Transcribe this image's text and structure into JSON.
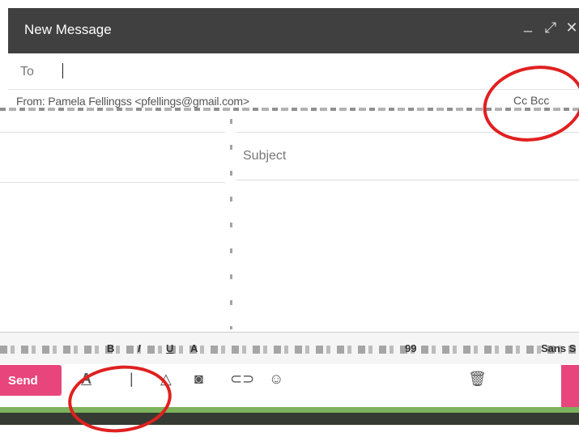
{
  "window": {
    "title": "New Message",
    "minimize_glyph": "_",
    "expand_glyph": "⤢",
    "close_glyph": "✕"
  },
  "compose": {
    "to_label": "To",
    "to_value": "",
    "from_text": "From: Pamela Fellingss <pfellings@gmail.com>",
    "cc_bcc": "Cc Bcc",
    "subject_placeholder": "Subject",
    "body": ""
  },
  "toolbar": {
    "font_family": "Sans S",
    "format_glyphs": {
      "bold": "B",
      "italic": "I",
      "underline": "U",
      "font_color": "A",
      "quote": "99"
    }
  },
  "bottom": {
    "send_label": "Send",
    "icons": [
      "format-text-icon",
      "attach-icon",
      "drive-icon",
      "photo-icon",
      "link-icon",
      "emoji-icon",
      "trash-icon"
    ],
    "format_glyph": "A",
    "attach_glyph": "|",
    "drive_glyph": "△",
    "photo_glyph": "◙",
    "link_glyph": "⊂⊃",
    "emoji_glyph": "☺",
    "trash_glyph": "🗑"
  },
  "colors": {
    "titlebar": "#404040",
    "send_button": "#e8457c",
    "highlight_ring": "#e02020",
    "strip_green": "#7db35d"
  }
}
